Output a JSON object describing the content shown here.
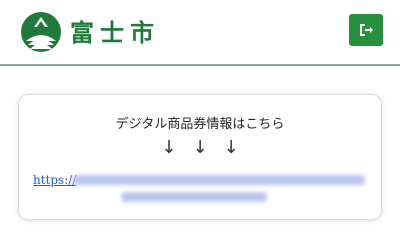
{
  "header": {
    "logo_text": "富士市",
    "exit_icon": "logout-icon",
    "colors": {
      "brand": "#1f7a3a",
      "button": "#27913f",
      "divider": "#8aa596"
    }
  },
  "card": {
    "title": "デジタル商品券情報はこちら",
    "arrows": [
      "↓",
      "↓",
      "↓"
    ],
    "link_prefix": "https://"
  }
}
